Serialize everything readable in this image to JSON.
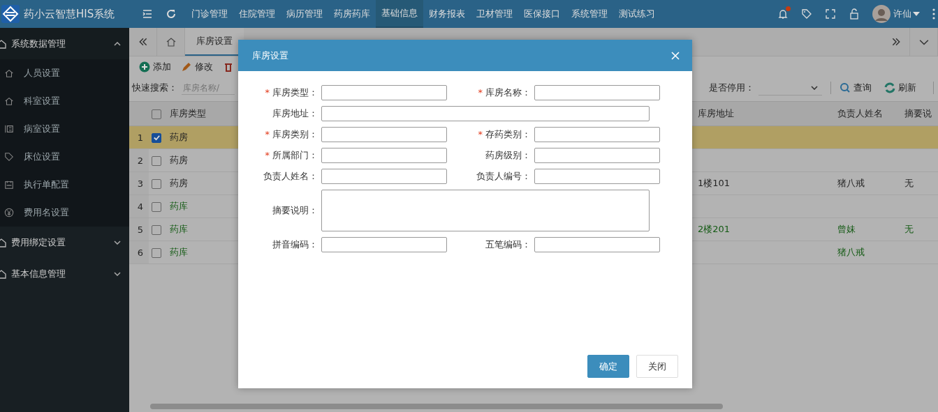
{
  "app": {
    "title": "药小云智慧HIS系统"
  },
  "nav": [
    {
      "label": "门诊管理",
      "selected": false
    },
    {
      "label": "住院管理",
      "selected": false
    },
    {
      "label": "病历管理",
      "selected": false
    },
    {
      "label": "药房药库",
      "selected": false
    },
    {
      "label": "基础信息",
      "selected": true
    },
    {
      "label": "财务报表",
      "selected": false
    },
    {
      "label": "卫材管理",
      "selected": false
    },
    {
      "label": "医保接口",
      "selected": false
    },
    {
      "label": "系统管理",
      "selected": false
    },
    {
      "label": "测试练习",
      "selected": false
    }
  ],
  "user": {
    "name": "许仙",
    "has_notification": true
  },
  "sidebar": [
    {
      "label": "系统数据管理",
      "expanded": true,
      "children": [
        {
          "label": "人员设置"
        },
        {
          "label": "科室设置"
        },
        {
          "label": "病室设置"
        },
        {
          "label": "床位设置"
        },
        {
          "label": "执行单配置"
        },
        {
          "label": "费用名设置"
        }
      ]
    },
    {
      "label": "费用绑定设置",
      "expanded": false
    },
    {
      "label": "基本信息管理",
      "expanded": false
    }
  ],
  "tabs": [
    {
      "label": "库房设置",
      "selected": true
    }
  ],
  "toolbar": [
    {
      "label": "添加"
    },
    {
      "label": "修改"
    }
  ],
  "search": {
    "label": "快速搜索：",
    "placeholder": "库房名称/"
  },
  "filter": {
    "label": "是否停用："
  },
  "actions": [
    {
      "label": "查询"
    },
    {
      "label": "刷新"
    }
  ],
  "table": {
    "all_checked": false,
    "columns": [
      "库房类型",
      "库房地址",
      "负责人姓名",
      "摘要说"
    ],
    "rows": [
      {
        "num": "1",
        "checked": true,
        "selected": true,
        "type": "药房",
        "address": "",
        "person": "",
        "note": "",
        "color": "#242424"
      },
      {
        "num": "2",
        "checked": false,
        "selected": false,
        "type": "药房",
        "address": "",
        "person": "",
        "note": "",
        "color": "#242424"
      },
      {
        "num": "3",
        "checked": false,
        "selected": false,
        "type": "药房",
        "address": "1楼101",
        "person": "猪八戒",
        "note": "无",
        "color": "#242424"
      },
      {
        "num": "4",
        "checked": false,
        "selected": false,
        "type": "药库",
        "address": "",
        "person": "",
        "note": "",
        "color": "#135a13"
      },
      {
        "num": "5",
        "checked": false,
        "selected": false,
        "type": "药库",
        "address": "2楼201",
        "person": "曾妹",
        "note": "无",
        "color": "#135a13"
      },
      {
        "num": "6",
        "checked": false,
        "selected": false,
        "type": "药库",
        "address": "",
        "person": "猪八戒",
        "note": "",
        "color": "#135a13"
      }
    ]
  },
  "dialog": {
    "title": "库房设置",
    "fields": [
      {
        "label": "库房类型：",
        "marker": "*",
        "kind": "short"
      },
      {
        "label": "库房名称：",
        "marker": "*",
        "kind": "short"
      },
      {
        "label": "库房地址：",
        "kind": "wide"
      },
      {
        "label": "库房类别：",
        "marker": "*",
        "kind": "short"
      },
      {
        "label": "存药类别：",
        "marker": "*",
        "kind": "short"
      },
      {
        "label": "所属部门：",
        "marker": "*",
        "kind": "short"
      },
      {
        "label": "药房级别：",
        "kind": "short"
      },
      {
        "label": "负责人姓名：",
        "kind": "short"
      },
      {
        "label": "负责人编号：",
        "kind": "short"
      },
      {
        "label": "摘要说明：",
        "kind": "textarea"
      },
      {
        "label": "拼音编码：",
        "kind": "short"
      },
      {
        "label": "五笔编码：",
        "kind": "short"
      }
    ],
    "buttons": [
      {
        "label": "确定",
        "primary": true
      },
      {
        "label": "关闭",
        "primary": false
      }
    ]
  }
}
